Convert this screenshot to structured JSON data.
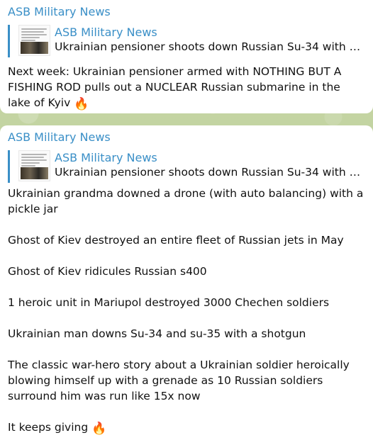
{
  "messages": [
    {
      "sender": "ASB Military News",
      "forward": {
        "title": "ASB Military News",
        "description": "Ukrainian pensioner shoots down Russian Su-34 with a r..."
      },
      "text": "Next week: Ukrainian pensioner armed with NOTHING BUT A FISHING ROD pulls out a NUCLEAR Russian submarine in the lake of Kyiv",
      "emoji": "🔥"
    },
    {
      "sender": "ASB Military News",
      "forward": {
        "title": "ASB Military News",
        "description": "Ukrainian pensioner shoots down Russian Su-34 with a r..."
      },
      "paragraphs": [
        "Ukrainian grandma downed a drone (with auto balancing) with a pickle jar",
        "Ghost of Kiev destroyed an entire fleet of Russian jets in May",
        "Ghost of Kiev ridicules Russian s400",
        "1 heroic unit in Mariupol destroyed 3000 Chechen soldiers",
        "Ukrainian man downs Su-34 and su-35 with a shotgun",
        "The classic war-hero story about a Ukrainian soldier heroically blowing himself up with a grenade as 10 Russian soldiers surround him was run like 15x now",
        "It keeps giving"
      ],
      "emoji": "🔥"
    }
  ],
  "icons": {
    "fire": "fire-icon"
  },
  "colors": {
    "accent": "#3a8fc7",
    "bubble": "#ffffff",
    "wallpaper": "#b9c99a"
  }
}
